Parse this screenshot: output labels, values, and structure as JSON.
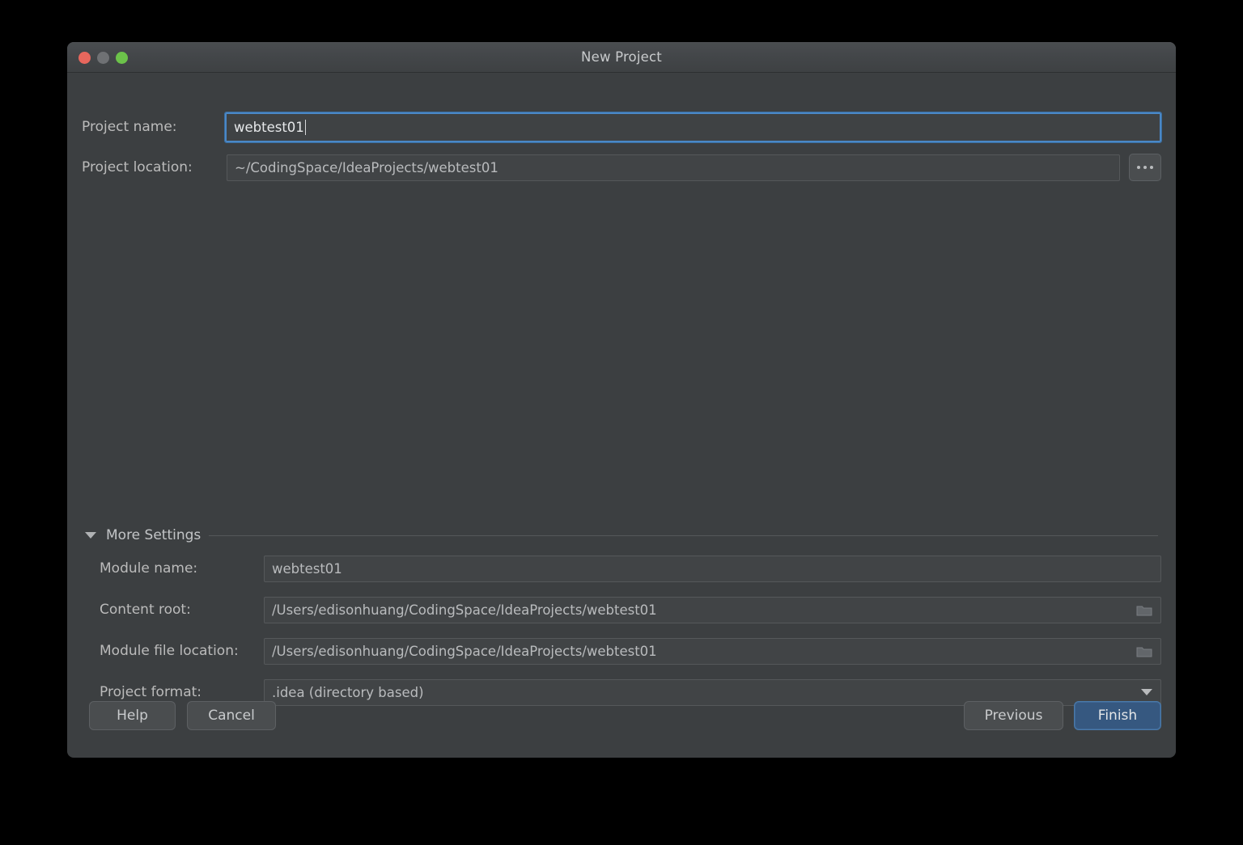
{
  "window": {
    "title": "New Project",
    "controls": [
      {
        "name": "close",
        "color": "#e8675d"
      },
      {
        "name": "minimize",
        "color": "#6f7174"
      },
      {
        "name": "maximize",
        "color": "#6cc24a"
      }
    ]
  },
  "form": {
    "project_name": {
      "label": "Project name:",
      "value": "webtest01",
      "placeholder": "",
      "focused": true
    },
    "project_location": {
      "label": "Project location:",
      "value": "~/CodingSpace/IdeaProjects/webtest01",
      "placeholder": "",
      "browse_label": "..."
    }
  },
  "more_settings": {
    "label": "More Settings",
    "expanded": true,
    "twisty_icon": "chevron-down-icon",
    "fields": {
      "module_name": {
        "label": "Module name:",
        "value": "webtest01",
        "placeholder": ""
      },
      "content_root": {
        "label": "Content root:",
        "value": "/Users/edisonhuang/CodingSpace/IdeaProjects/webtest01",
        "placeholder": "",
        "icon": "folder-icon"
      },
      "module_file_location": {
        "label": "Module file location:",
        "value": "/Users/edisonhuang/CodingSpace/IdeaProjects/webtest01",
        "placeholder": "",
        "icon": "folder-icon"
      },
      "project_format": {
        "label": "Project format:",
        "value": ".idea (directory based)",
        "icon": "chevron-down-icon",
        "options": [
          ".idea (directory based)"
        ]
      }
    }
  },
  "footer": {
    "help_label": "Help",
    "cancel_label": "Cancel",
    "previous_label": "Previous",
    "finish_label": "Finish"
  },
  "colors": {
    "dialog_background": "#3c3f41",
    "titlebar": "#43464a",
    "field_background": "#45494a",
    "accent_focus": "#4a88c7",
    "primary_button": "#365880",
    "text": "#bbbbbb"
  }
}
